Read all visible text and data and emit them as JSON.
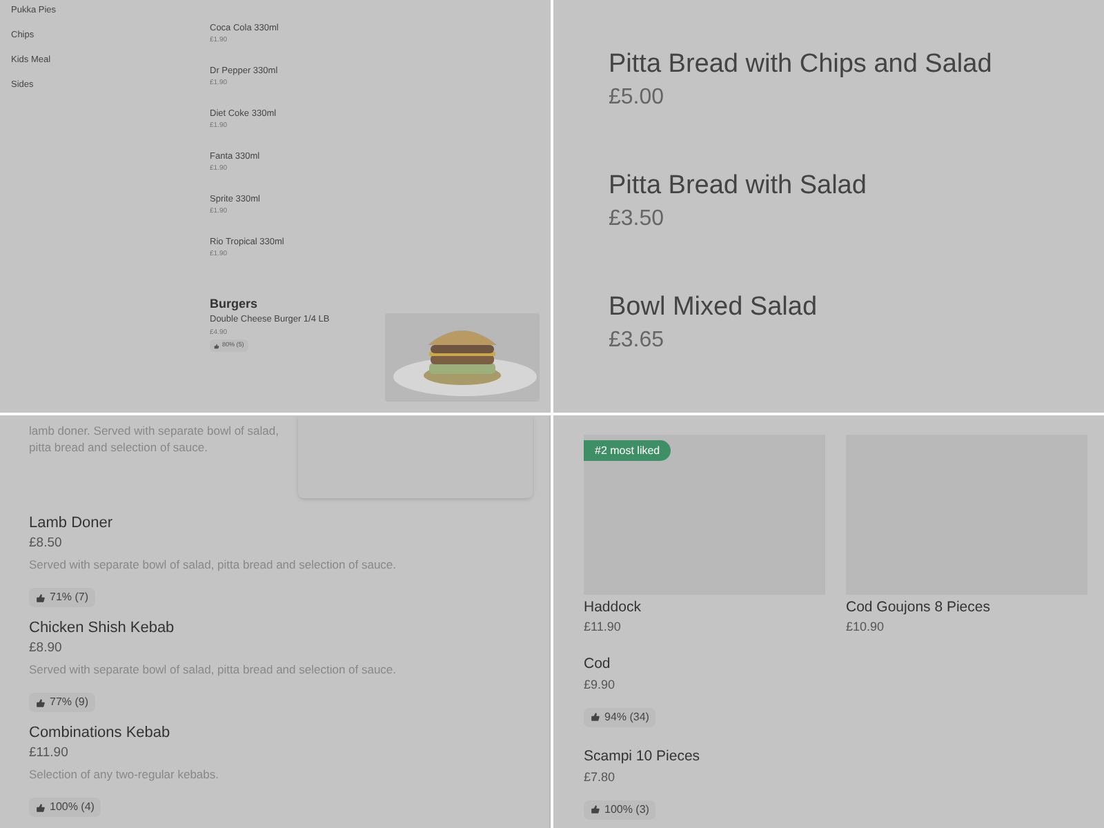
{
  "top_left": {
    "categories": [
      {
        "label": "Pukka Pies"
      },
      {
        "label": "Chips"
      },
      {
        "label": "Kids Meal"
      },
      {
        "label": "Sides"
      }
    ],
    "items": [
      {
        "name": "Coca Cola 330ml",
        "price": "£1.90"
      },
      {
        "name": "Dr Pepper 330ml",
        "price": "£1.90"
      },
      {
        "name": "Diet Coke 330ml",
        "price": "£1.90"
      },
      {
        "name": "Fanta 330ml",
        "price": "£1.90"
      },
      {
        "name": "Sprite 330ml",
        "price": "£1.90"
      },
      {
        "name": "Rio Tropical 330ml",
        "price": "£1.90"
      }
    ],
    "section": {
      "title": "Burgers",
      "items": [
        {
          "name": "Double Cheese Burger 1/4 LB",
          "price": "£4.90",
          "rating": "80% (5)",
          "kind": "picture"
        }
      ]
    }
  },
  "top_right": {
    "items": [
      {
        "name": "Pitta Bread with Chips and Salad",
        "price": "£5.00"
      },
      {
        "name": "Pitta Bread with Salad",
        "price": "£3.50"
      },
      {
        "name": "Bowl Mixed Salad",
        "price": "£3.65"
      }
    ]
  },
  "bottom_left": {
    "description": "lamb doner. Served with separate bowl of salad, pitta bread and selection of sauce.",
    "items": [
      {
        "name": "Lamb Doner",
        "price": "£8.50",
        "description": "Served with separate bowl of salad, pitta bread and selection of sauce.",
        "rating": "71% (7)"
      },
      {
        "name": "Chicken Shish Kebab",
        "price": "£8.90",
        "description": "Served with separate bowl of salad, pitta bread and selection of sauce.",
        "rating": "77% (9)"
      },
      {
        "name": "Combinations Kebab",
        "price": "£11.90",
        "description": "Selection of any two-regular kebabs.",
        "rating": "100% (4)"
      }
    ]
  },
  "bottom_right": {
    "cards": [
      {
        "name": "Haddock",
        "price": "£11.90",
        "badge": "#2 most liked"
      },
      {
        "name": "Cod Goujons 8 Pieces",
        "price": "£10.90"
      }
    ],
    "items": [
      {
        "name": "Cod",
        "price": "£9.90",
        "rating": "94% (34)"
      },
      {
        "name": "Scampi 10 Pieces",
        "price": "£7.80",
        "rating": "100% (3)"
      }
    ]
  }
}
